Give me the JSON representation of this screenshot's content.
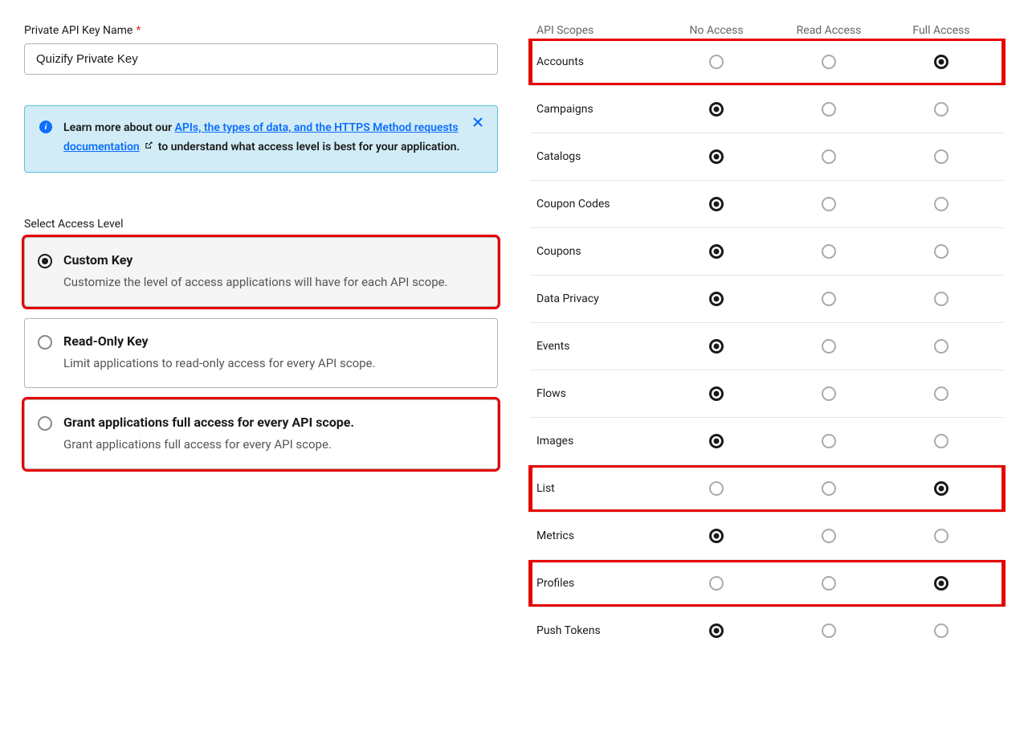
{
  "api_key_name_label": "Private API Key Name",
  "api_key_name_value": "Quizify Private Key",
  "info_callout": {
    "prefix": "Learn more about our ",
    "link_text": "APIs, the types of data, and the HTTPS Method requests documentation",
    "suffix": " to understand what access level is best for your application."
  },
  "access_level_heading": "Select Access Level",
  "access_options": [
    {
      "title": "Custom Key",
      "desc": "Customize the level of access applications will have for each API scope.",
      "selected": true,
      "highlighted": true
    },
    {
      "title": "Read-Only Key",
      "desc": "Limit applications to read-only access for every API scope.",
      "selected": false,
      "highlighted": false
    },
    {
      "title": "Grant applications full access for every API scope.",
      "desc": "Grant applications full access for every API scope.",
      "selected": false,
      "highlighted": true
    }
  ],
  "scopes_header": {
    "name": "API Scopes",
    "col_no": "No Access",
    "col_read": "Read Access",
    "col_full": "Full Access"
  },
  "scopes": [
    {
      "name": "Accounts",
      "value": "full",
      "highlighted": true
    },
    {
      "name": "Campaigns",
      "value": "none",
      "highlighted": false
    },
    {
      "name": "Catalogs",
      "value": "none",
      "highlighted": false
    },
    {
      "name": "Coupon Codes",
      "value": "none",
      "highlighted": false
    },
    {
      "name": "Coupons",
      "value": "none",
      "highlighted": false
    },
    {
      "name": "Data Privacy",
      "value": "none",
      "highlighted": false
    },
    {
      "name": "Events",
      "value": "none",
      "highlighted": false
    },
    {
      "name": "Flows",
      "value": "none",
      "highlighted": false
    },
    {
      "name": "Images",
      "value": "none",
      "highlighted": false
    },
    {
      "name": "List",
      "value": "full",
      "highlighted": true
    },
    {
      "name": "Metrics",
      "value": "none",
      "highlighted": false
    },
    {
      "name": "Profiles",
      "value": "full",
      "highlighted": true
    },
    {
      "name": "Push Tokens",
      "value": "none",
      "highlighted": false
    }
  ]
}
